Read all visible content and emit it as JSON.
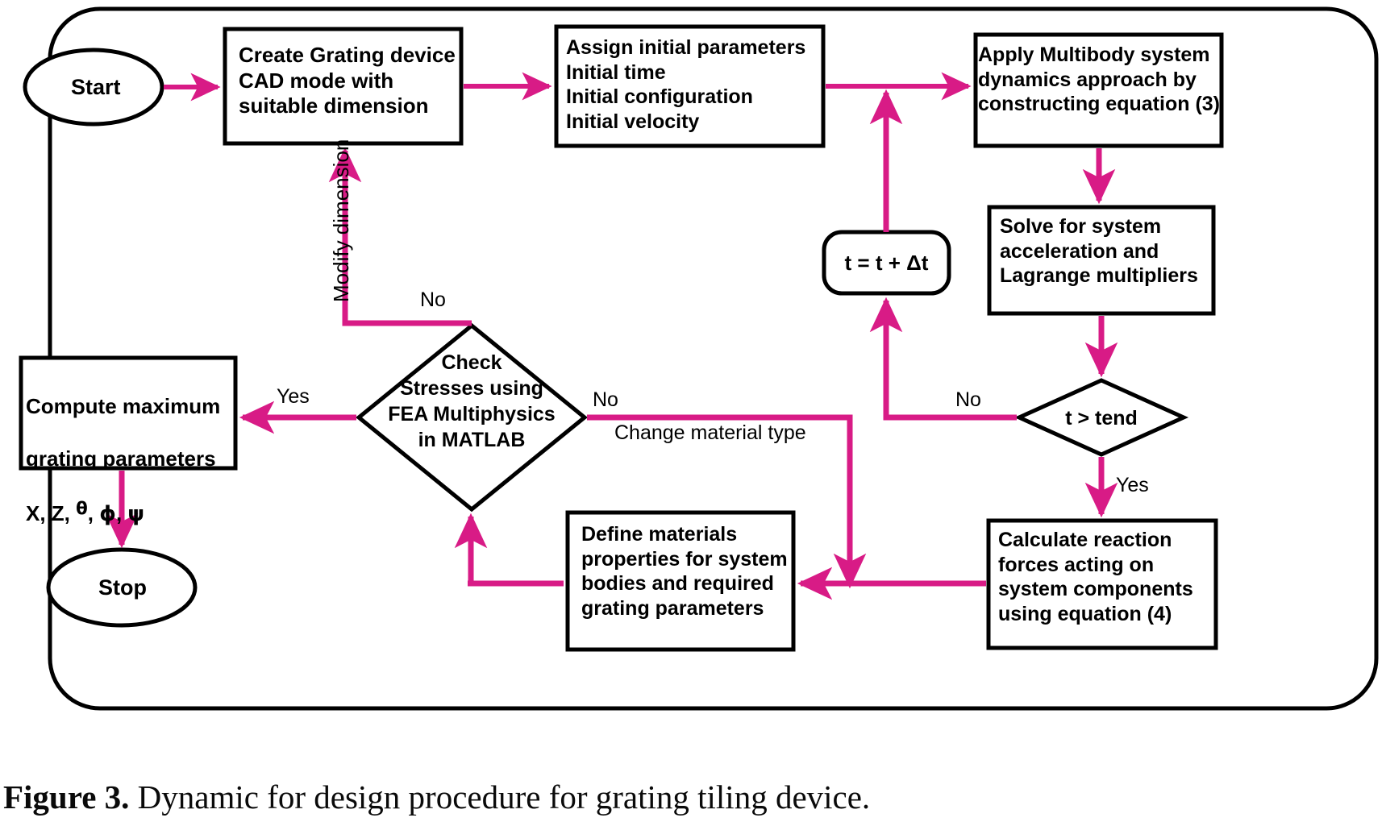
{
  "figure": {
    "caption_bold": "Figure 3.",
    "caption_text": " Dynamic for design procedure for grating tiling device."
  },
  "colors": {
    "arrow": "#D81B86",
    "outline": "#000000",
    "fill": "#FFFFFF",
    "background": "#FFFFFF"
  },
  "nodes": {
    "start": {
      "label": "Start",
      "shape": "ellipse"
    },
    "stop": {
      "label": "Stop",
      "shape": "ellipse"
    },
    "create_cad": {
      "label": "Create Grating device\nCAD mode with\nsuitable dimension",
      "shape": "rect"
    },
    "assign_params": {
      "label": "Assign initial parameters\nInitial time\nInitial configuration\nInitial velocity",
      "shape": "rect"
    },
    "apply_multibody": {
      "label": "Apply Multibody system\ndynamics approach by\nconstructing equation (3)",
      "shape": "rect"
    },
    "solve_system": {
      "label": "Solve for system\nacceleration and\nLagrange multipliers",
      "shape": "rect"
    },
    "time_step": {
      "label": "t = t +  Δt",
      "shape": "rounded-rect"
    },
    "t_gt_tend": {
      "label": "t > tend",
      "shape": "diamond"
    },
    "calc_reaction": {
      "label": "Calculate reaction\nforces acting on\nsystem components\nusing equation (4)",
      "shape": "rect"
    },
    "define_materials": {
      "label": "Define materials\nproperties for system\nbodies and required\ngrating parameters",
      "shape": "rect"
    },
    "check_stresses": {
      "label": "Check\nStresses using\nFEA Multiphysics\nin MATLAB",
      "shape": "diamond"
    },
    "compute_max": {
      "line1": "Compute maximum",
      "line2": "grating parameters",
      "line3_prefix": "X, Z, ",
      "line3_theta": "θ",
      "line3_sep1": ", ",
      "line3_phi": "ϕ",
      "line3_sep2": ",  ",
      "line3_psi": "ψ",
      "shape": "rect"
    }
  },
  "edge_labels": {
    "modify_dimension": "Modify dimension",
    "check_no_up": "No",
    "check_yes_left": "Yes",
    "check_no_right": "No",
    "change_material_type": "Change material type",
    "tend_no": "No",
    "tend_yes": "Yes"
  }
}
